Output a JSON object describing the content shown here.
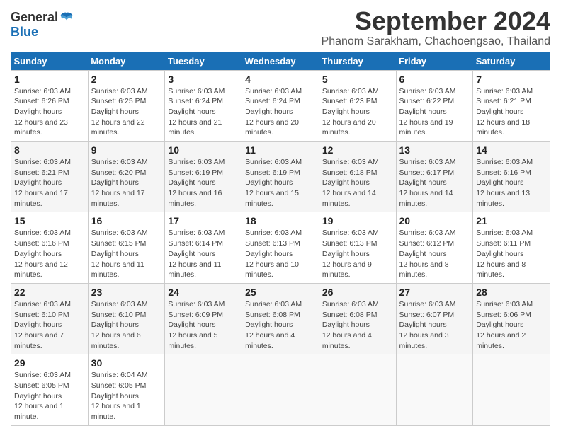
{
  "header": {
    "logo_general": "General",
    "logo_blue": "Blue",
    "month_title": "September 2024",
    "subtitle": "Phanom Sarakham, Chachoengsao, Thailand"
  },
  "calendar": {
    "headers": [
      "Sunday",
      "Monday",
      "Tuesday",
      "Wednesday",
      "Thursday",
      "Friday",
      "Saturday"
    ],
    "weeks": [
      [
        null,
        {
          "day": "2",
          "sunrise": "6:03 AM",
          "sunset": "6:25 PM",
          "daylight": "12 hours and 22 minutes."
        },
        {
          "day": "3",
          "sunrise": "6:03 AM",
          "sunset": "6:24 PM",
          "daylight": "12 hours and 21 minutes."
        },
        {
          "day": "4",
          "sunrise": "6:03 AM",
          "sunset": "6:24 PM",
          "daylight": "12 hours and 20 minutes."
        },
        {
          "day": "5",
          "sunrise": "6:03 AM",
          "sunset": "6:23 PM",
          "daylight": "12 hours and 20 minutes."
        },
        {
          "day": "6",
          "sunrise": "6:03 AM",
          "sunset": "6:22 PM",
          "daylight": "12 hours and 19 minutes."
        },
        {
          "day": "7",
          "sunrise": "6:03 AM",
          "sunset": "6:21 PM",
          "daylight": "12 hours and 18 minutes."
        }
      ],
      [
        {
          "day": "1",
          "sunrise": "6:03 AM",
          "sunset": "6:26 PM",
          "daylight": "12 hours and 23 minutes."
        },
        {
          "day": "8",
          "sunrise": "6:03 AM",
          "sunset": "6:21 PM",
          "daylight": "12 hours and 17 minutes."
        },
        {
          "day": "9",
          "sunrise": "6:03 AM",
          "sunset": "6:20 PM",
          "daylight": "12 hours and 17 minutes."
        },
        {
          "day": "10",
          "sunrise": "6:03 AM",
          "sunset": "6:19 PM",
          "daylight": "12 hours and 16 minutes."
        },
        {
          "day": "11",
          "sunrise": "6:03 AM",
          "sunset": "6:19 PM",
          "daylight": "12 hours and 15 minutes."
        },
        {
          "day": "12",
          "sunrise": "6:03 AM",
          "sunset": "6:18 PM",
          "daylight": "12 hours and 14 minutes."
        },
        {
          "day": "13",
          "sunrise": "6:03 AM",
          "sunset": "6:17 PM",
          "daylight": "12 hours and 14 minutes."
        }
      ],
      [
        {
          "day": "14",
          "sunrise": "6:03 AM",
          "sunset": "6:16 PM",
          "daylight": "12 hours and 13 minutes."
        },
        {
          "day": "15",
          "sunrise": "6:03 AM",
          "sunset": "6:16 PM",
          "daylight": "12 hours and 12 minutes."
        },
        {
          "day": "16",
          "sunrise": "6:03 AM",
          "sunset": "6:15 PM",
          "daylight": "12 hours and 11 minutes."
        },
        {
          "day": "17",
          "sunrise": "6:03 AM",
          "sunset": "6:14 PM",
          "daylight": "12 hours and 11 minutes."
        },
        {
          "day": "18",
          "sunrise": "6:03 AM",
          "sunset": "6:13 PM",
          "daylight": "12 hours and 10 minutes."
        },
        {
          "day": "19",
          "sunrise": "6:03 AM",
          "sunset": "6:13 PM",
          "daylight": "12 hours and 9 minutes."
        },
        {
          "day": "20",
          "sunrise": "6:03 AM",
          "sunset": "6:12 PM",
          "daylight": "12 hours and 8 minutes."
        }
      ],
      [
        {
          "day": "21",
          "sunrise": "6:03 AM",
          "sunset": "6:11 PM",
          "daylight": "12 hours and 8 minutes."
        },
        {
          "day": "22",
          "sunrise": "6:03 AM",
          "sunset": "6:10 PM",
          "daylight": "12 hours and 7 minutes."
        },
        {
          "day": "23",
          "sunrise": "6:03 AM",
          "sunset": "6:10 PM",
          "daylight": "12 hours and 6 minutes."
        },
        {
          "day": "24",
          "sunrise": "6:03 AM",
          "sunset": "6:09 PM",
          "daylight": "12 hours and 5 minutes."
        },
        {
          "day": "25",
          "sunrise": "6:03 AM",
          "sunset": "6:08 PM",
          "daylight": "12 hours and 4 minutes."
        },
        {
          "day": "26",
          "sunrise": "6:03 AM",
          "sunset": "6:08 PM",
          "daylight": "12 hours and 4 minutes."
        },
        {
          "day": "27",
          "sunrise": "6:03 AM",
          "sunset": "6:07 PM",
          "daylight": "12 hours and 3 minutes."
        }
      ],
      [
        {
          "day": "28",
          "sunrise": "6:03 AM",
          "sunset": "6:06 PM",
          "daylight": "12 hours and 2 minutes."
        },
        {
          "day": "29",
          "sunrise": "6:03 AM",
          "sunset": "6:05 PM",
          "daylight": "12 hours and 1 minute."
        },
        {
          "day": "30",
          "sunrise": "6:04 AM",
          "sunset": "6:05 PM",
          "daylight": "12 hours and 1 minute."
        },
        null,
        null,
        null,
        null
      ]
    ]
  }
}
